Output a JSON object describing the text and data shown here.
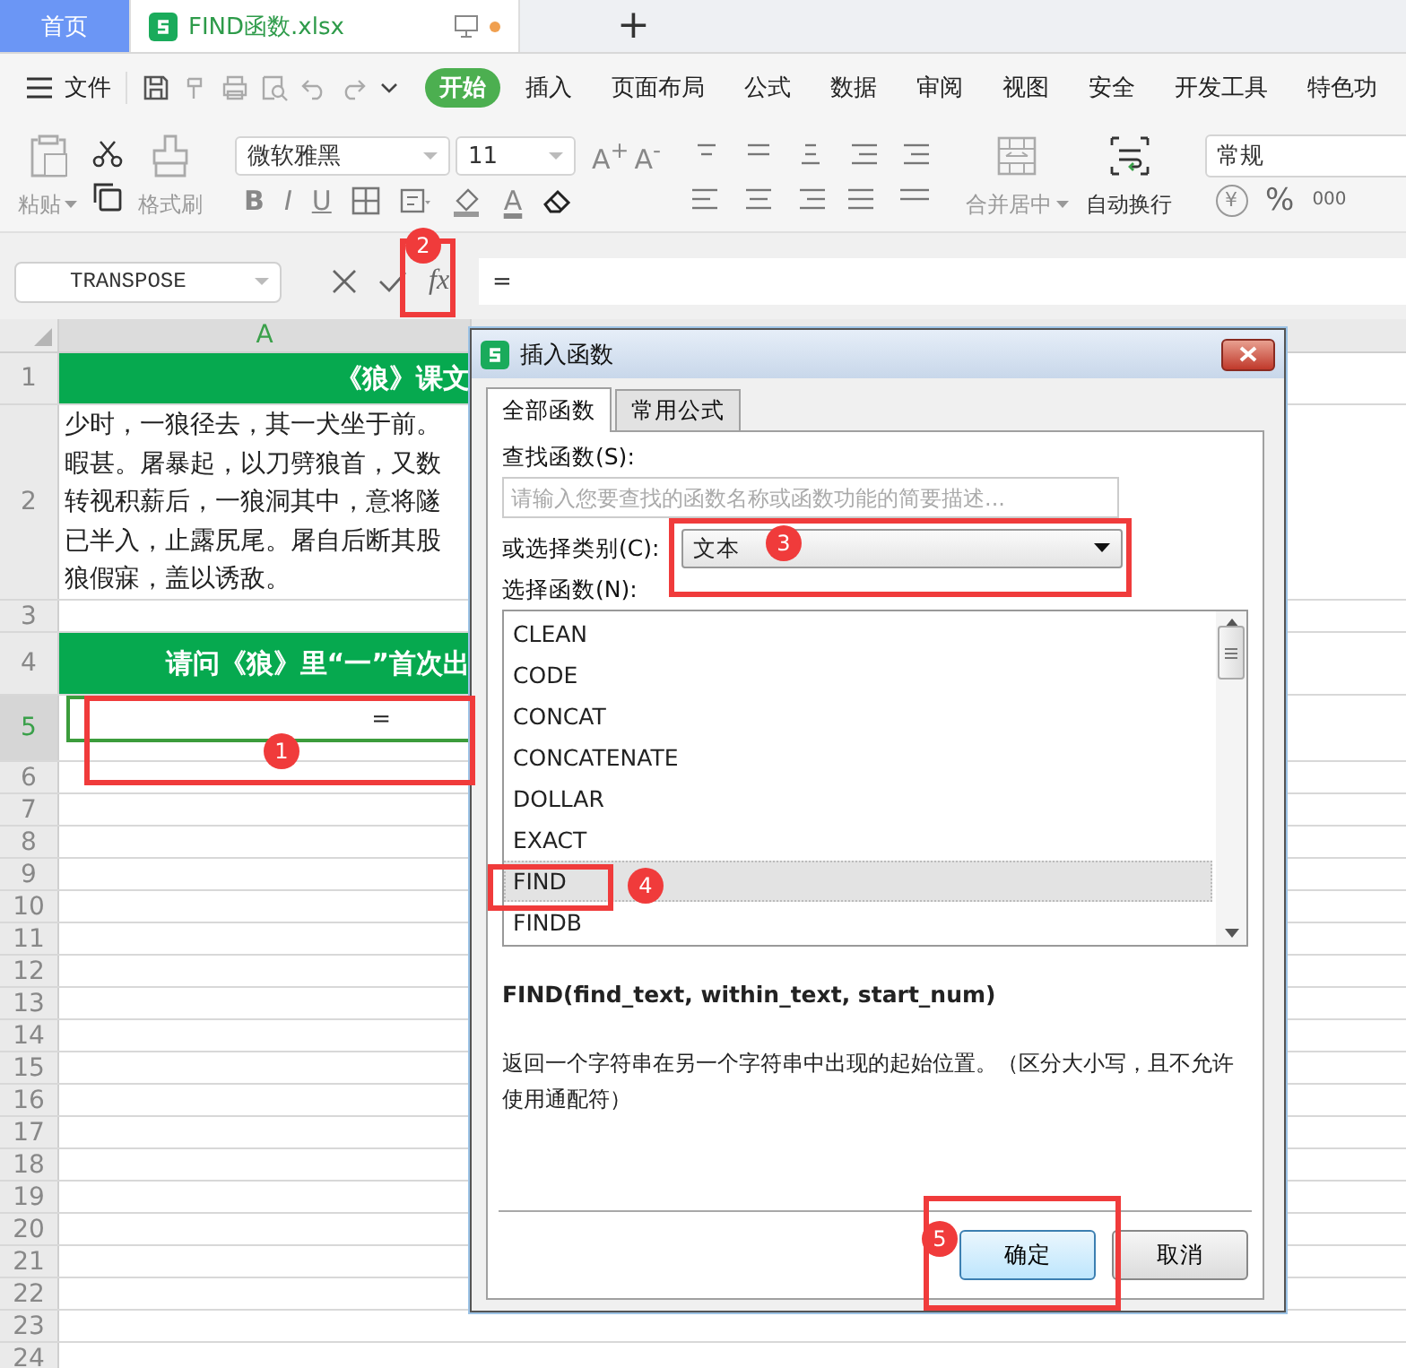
{
  "tabs": [
    {
      "label": "首页",
      "kind": "home",
      "selected": false
    },
    {
      "label": "FIND函数.xlsx",
      "kind": "file",
      "selected": true
    }
  ],
  "new_tab": "+",
  "menu": {
    "file": "文件",
    "items": [
      {
        "label": "开始",
        "selected": true
      },
      {
        "label": "插入",
        "selected": false
      },
      {
        "label": "页面布局",
        "selected": false
      },
      {
        "label": "公式",
        "selected": false
      },
      {
        "label": "数据",
        "selected": false
      },
      {
        "label": "审阅",
        "selected": false
      },
      {
        "label": "视图",
        "selected": false
      },
      {
        "label": "安全",
        "selected": false
      },
      {
        "label": "开发工具",
        "selected": false
      },
      {
        "label": "特色功",
        "selected": false
      }
    ]
  },
  "ribbon": {
    "paste": {
      "label": "粘贴",
      "disabled": true
    },
    "format_painter": {
      "label": "格式刷",
      "disabled": true
    },
    "font": "微软雅黑",
    "font_size": "11",
    "grow_font": "A$^{+}$",
    "shrink_font": "A$^{-}$",
    "style_buttons": [
      "B",
      "I",
      "U"
    ],
    "font_color": "A",
    "merge": {
      "label": "合并居中",
      "disabled": true
    },
    "wrap": {
      "label": "自动换行",
      "disabled": false
    },
    "number_format": "常规",
    "currency": "¥",
    "percent": "%",
    "thousands": "000"
  },
  "formula_bar": {
    "name_box": "TRANSPOSE",
    "function_button": "fx",
    "formula": "="
  },
  "sheet": {
    "columns": [
      {
        "label": "A",
        "selected": true
      }
    ],
    "rows": [
      {
        "header": "1",
        "kind": "title",
        "text": "《狼》课文",
        "selected": false
      },
      {
        "header": "2",
        "kind": "body",
        "lines": [
          "少时，一狼径去，其一犬坐于前。",
          "暇甚。屠暴起，以刀劈狼首，又数",
          "转视积薪后，一狼洞其中，意将隧",
          "已半入，止露尻尾。屠自后断其股",
          "狼假寐，盖以诱敌。"
        ],
        "selected": false
      },
      {
        "header": "3",
        "kind": "empty",
        "selected": false
      },
      {
        "header": "4",
        "kind": "title",
        "text": "请问《狼》里“一”首次出",
        "selected": false
      },
      {
        "header": "5",
        "kind": "formula",
        "text": "=",
        "selected": true
      },
      {
        "header": "6",
        "kind": "empty",
        "selected": false
      },
      {
        "header": "7",
        "kind": "empty",
        "selected": false
      },
      {
        "header": "8",
        "kind": "empty",
        "selected": false
      },
      {
        "header": "9",
        "kind": "empty",
        "selected": false
      },
      {
        "header": "10",
        "kind": "empty",
        "selected": false
      },
      {
        "header": "11",
        "kind": "empty",
        "selected": false
      },
      {
        "header": "12",
        "kind": "empty",
        "selected": false
      },
      {
        "header": "13",
        "kind": "empty",
        "selected": false
      },
      {
        "header": "14",
        "kind": "empty",
        "selected": false
      },
      {
        "header": "15",
        "kind": "empty",
        "selected": false
      },
      {
        "header": "16",
        "kind": "empty",
        "selected": false
      },
      {
        "header": "17",
        "kind": "empty",
        "selected": false
      },
      {
        "header": "18",
        "kind": "empty",
        "selected": false
      },
      {
        "header": "19",
        "kind": "empty",
        "selected": false
      },
      {
        "header": "20",
        "kind": "empty",
        "selected": false
      },
      {
        "header": "21",
        "kind": "empty",
        "selected": false
      },
      {
        "header": "22",
        "kind": "empty",
        "selected": false
      },
      {
        "header": "23",
        "kind": "empty",
        "selected": false
      },
      {
        "header": "24",
        "kind": "empty",
        "selected": false
      }
    ]
  },
  "dialog": {
    "title": "插入函数",
    "tabs": [
      {
        "label": "全部函数",
        "selected": true
      },
      {
        "label": "常用公式",
        "selected": false
      }
    ],
    "search_label": "查找函数(S):",
    "search_placeholder": "请输入您要查找的函数名称或函数功能的简要描述...",
    "category_label": "或选择类别(C):",
    "category": "文本",
    "list_label": "选择函数(N):",
    "functions": [
      {
        "name": "CLEAN",
        "selected": false
      },
      {
        "name": "CODE",
        "selected": false
      },
      {
        "name": "CONCAT",
        "selected": false
      },
      {
        "name": "CONCATENATE",
        "selected": false
      },
      {
        "name": "DOLLAR",
        "selected": false
      },
      {
        "name": "EXACT",
        "selected": false
      },
      {
        "name": "FIND",
        "selected": true
      },
      {
        "name": "FINDB",
        "selected": false
      }
    ],
    "signature": "FIND(find_text, within_text, start_num)",
    "description": "返回一个字符串在另一个字符串中出现的起始位置。（区分大小写，且不允许使用通配符）",
    "buttons": [
      {
        "label": "确定",
        "kind": "primary"
      },
      {
        "label": "取消",
        "kind": "secondary"
      }
    ]
  },
  "annotations": [
    {
      "label": "1"
    },
    {
      "label": "2"
    },
    {
      "label": "3"
    },
    {
      "label": "4"
    },
    {
      "label": "5"
    }
  ]
}
